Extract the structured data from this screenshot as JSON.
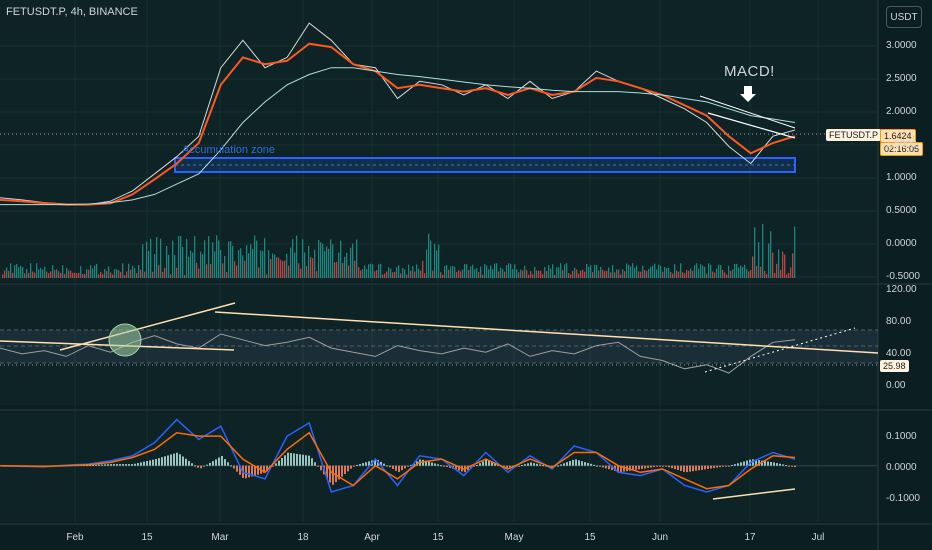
{
  "header": {
    "symbol": "FETUSDT.P, 4h, BINANCE",
    "currency_button": "USDT"
  },
  "annotations": {
    "macd_call": "MACD!",
    "accumulation": "Accumulation zone"
  },
  "price_tags": {
    "symbol_tag": "FETUSDT.P",
    "last_price": "1.6424",
    "countdown": "02:16:05",
    "rsi_value": "25.98"
  },
  "colors": {
    "background": "#0b1f22",
    "price_line": "#d9d9d9",
    "ema_fast": "#ff5722",
    "ema_slow": "#ff9800",
    "sma_long": "#b2dfdb",
    "accum_zone": "#2962ff",
    "volume_up": "#26a69a",
    "volume_down": "#ef5350",
    "macd_line": "#2962ff",
    "signal_line": "#ff6d00",
    "rsi_line": "#9e9e9e",
    "trendline": "#ffe0b2",
    "circle_marker": "#a5d6a7"
  },
  "chart_data": [
    {
      "type": "line",
      "panel": "price",
      "title": "",
      "y_ticks": [
        "3.0000",
        "2.5000",
        "2.0000",
        "1.5000",
        "1.0000",
        "0.5000",
        "0.0000",
        "-0.5000"
      ],
      "ylim": [
        -0.55,
        3.45
      ],
      "x_ticks": [
        "Feb",
        "15",
        "Mar",
        "18",
        "Apr",
        "15",
        "May",
        "15",
        "Jun",
        "17",
        "Jul"
      ],
      "series": [
        {
          "values": [
            0.65,
            0.62,
            0.58,
            0.56,
            0.55,
            0.6,
            0.75,
            1.0,
            1.25,
            1.55,
            2.55,
            2.95,
            2.55,
            2.7,
            3.2,
            2.95,
            2.6,
            2.55,
            2.1,
            2.35,
            2.3,
            2.15,
            2.3,
            2.1,
            2.35,
            2.1,
            2.2,
            2.5,
            2.35,
            2.25,
            2.1,
            1.95,
            1.75,
            1.4,
            1.15,
            1.55,
            1.64
          ]
        },
        {
          "values": [
            0.62,
            0.6,
            0.57,
            0.55,
            0.55,
            0.57,
            0.7,
            0.92,
            1.15,
            1.45,
            2.3,
            2.7,
            2.6,
            2.65,
            2.9,
            2.85,
            2.6,
            2.5,
            2.25,
            2.3,
            2.25,
            2.2,
            2.25,
            2.15,
            2.25,
            2.15,
            2.2,
            2.4,
            2.35,
            2.25,
            2.15,
            2.0,
            1.85,
            1.55,
            1.3,
            1.45,
            1.55
          ]
        },
        {
          "values": [
            0.55,
            0.55,
            0.55,
            0.55,
            0.56,
            0.58,
            0.62,
            0.7,
            0.85,
            1.0,
            1.35,
            1.75,
            2.05,
            2.3,
            2.45,
            2.55,
            2.55,
            2.5,
            2.45,
            2.42,
            2.38,
            2.34,
            2.3,
            2.27,
            2.25,
            2.22,
            2.2,
            2.2,
            2.2,
            2.18,
            2.15,
            2.1,
            2.05,
            1.95,
            1.85,
            1.8,
            1.75
          ]
        }
      ],
      "accumulation_zone": [
        1.08,
        1.3
      ]
    },
    {
      "type": "bar",
      "panel": "volume",
      "title": ""
    },
    {
      "type": "line",
      "panel": "rsi",
      "title": "",
      "y_ticks": [
        "120.00",
        "80.00",
        "40.00",
        "0.00"
      ],
      "ylim": [
        -10,
        125
      ],
      "upper_band": 70,
      "lower_band": 30,
      "series": [
        {
          "values": [
            55,
            48,
            52,
            45,
            58,
            50,
            62,
            70,
            60,
            55,
            72,
            65,
            58,
            62,
            68,
            55,
            50,
            45,
            58,
            52,
            48,
            55,
            50,
            60,
            45,
            52,
            48,
            58,
            62,
            45,
            40,
            30,
            35,
            25,
            45,
            62,
            65
          ]
        }
      ]
    },
    {
      "type": "line",
      "panel": "macd",
      "title": "",
      "y_ticks": [
        "0.1000",
        "0.0000",
        "-0.1000"
      ],
      "ylim": [
        -0.165,
        0.145
      ],
      "series": [
        {
          "values": [
            0.0,
            -0.002,
            -0.003,
            0.002,
            0.005,
            0.015,
            0.03,
            0.07,
            0.14,
            0.08,
            0.12,
            -0.02,
            -0.04,
            0.09,
            0.13,
            -0.08,
            -0.06,
            0.02,
            -0.06,
            0.03,
            0.02,
            -0.03,
            0.04,
            -0.02,
            0.03,
            -0.01,
            0.06,
            0.04,
            -0.02,
            -0.03,
            -0.01,
            -0.06,
            -0.08,
            -0.06,
            0.01,
            0.04,
            0.02
          ]
        },
        {
          "values": [
            0.0,
            -0.001,
            -0.002,
            0.0,
            0.003,
            0.01,
            0.025,
            0.05,
            0.1,
            0.09,
            0.09,
            0.02,
            -0.02,
            0.05,
            0.1,
            -0.02,
            -0.06,
            0.0,
            -0.04,
            0.01,
            0.02,
            -0.01,
            0.02,
            -0.01,
            0.02,
            -0.005,
            0.04,
            0.04,
            0.0,
            -0.02,
            -0.01,
            -0.04,
            -0.07,
            -0.06,
            -0.01,
            0.03,
            0.025
          ]
        }
      ]
    }
  ]
}
